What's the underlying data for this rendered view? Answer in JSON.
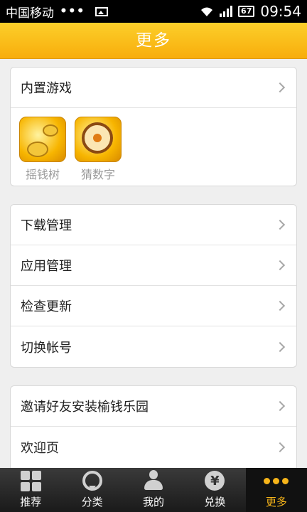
{
  "status_bar": {
    "carrier": "中国移动",
    "dots": "•••",
    "battery": "67",
    "time": "09:54"
  },
  "title": "更多",
  "games_section": {
    "header": "内置游戏",
    "games": [
      {
        "name": "摇钱树",
        "icon": "money-tree-icon"
      },
      {
        "name": "猜数字",
        "icon": "guess-number-icon"
      }
    ]
  },
  "manage_section": {
    "items": [
      {
        "label": "下载管理"
      },
      {
        "label": "应用管理"
      },
      {
        "label": "检查更新"
      },
      {
        "label": "切换帐号"
      }
    ]
  },
  "other_section": {
    "items": [
      {
        "label": "邀请好友安装榆钱乐园"
      },
      {
        "label": "欢迎页"
      }
    ]
  },
  "bottom_nav": {
    "items": [
      {
        "label": "推荐",
        "icon": "grid-icon"
      },
      {
        "label": "分类",
        "icon": "location-pin-icon"
      },
      {
        "label": "我的",
        "icon": "person-icon"
      },
      {
        "label": "兑换",
        "icon": "yen-icon"
      },
      {
        "label": "更多",
        "icon": "more-dots-icon",
        "active": true
      }
    ],
    "active_color": "#f7b51a"
  },
  "colors": {
    "title_bar": "#f8ad0c",
    "background": "#efefef"
  }
}
